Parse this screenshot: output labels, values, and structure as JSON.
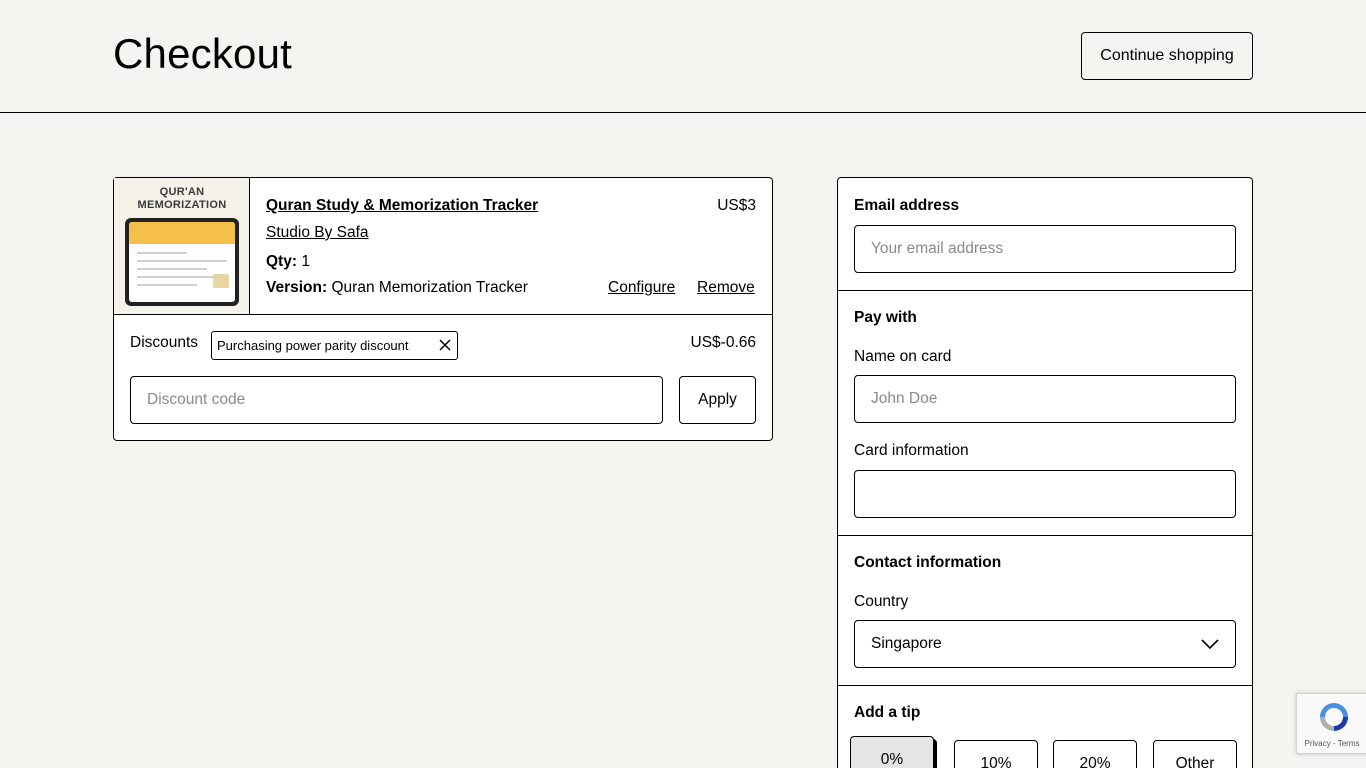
{
  "header": {
    "title": "Checkout",
    "continue_label": "Continue shopping"
  },
  "cart": {
    "thumbnail_text": "QUR'AN MEMORIZATION",
    "item": {
      "title": "Quran Study & Memorization Tracker",
      "seller": "Studio By Safa",
      "price": "US$3",
      "qty_label": "Qty:",
      "qty_value": "1",
      "version_label": "Version:",
      "version_value": "Quran Memorization Tracker",
      "configure_label": "Configure",
      "remove_label": "Remove"
    },
    "discounts": {
      "label": "Discounts",
      "chip_label": "Purchasing power parity discount",
      "amount": "US$-0.66",
      "input_placeholder": "Discount code",
      "apply_label": "Apply"
    }
  },
  "payment": {
    "email": {
      "heading": "Email address",
      "placeholder": "Your email address"
    },
    "pay_with": {
      "heading": "Pay with",
      "name_label": "Name on card",
      "name_placeholder": "John Doe",
      "card_label": "Card information"
    },
    "contact": {
      "heading": "Contact information",
      "country_label": "Country",
      "country_value": "Singapore"
    },
    "tip": {
      "heading": "Add a tip",
      "options": [
        "0%",
        "10%",
        "20%",
        "Other"
      ],
      "selected": "0%"
    }
  },
  "recaptcha": {
    "privacy_terms": "Privacy - Terms"
  },
  "colors": {
    "background": "#f4f4f0",
    "border": "#000000",
    "thumb_accent": "#f5c04a"
  }
}
